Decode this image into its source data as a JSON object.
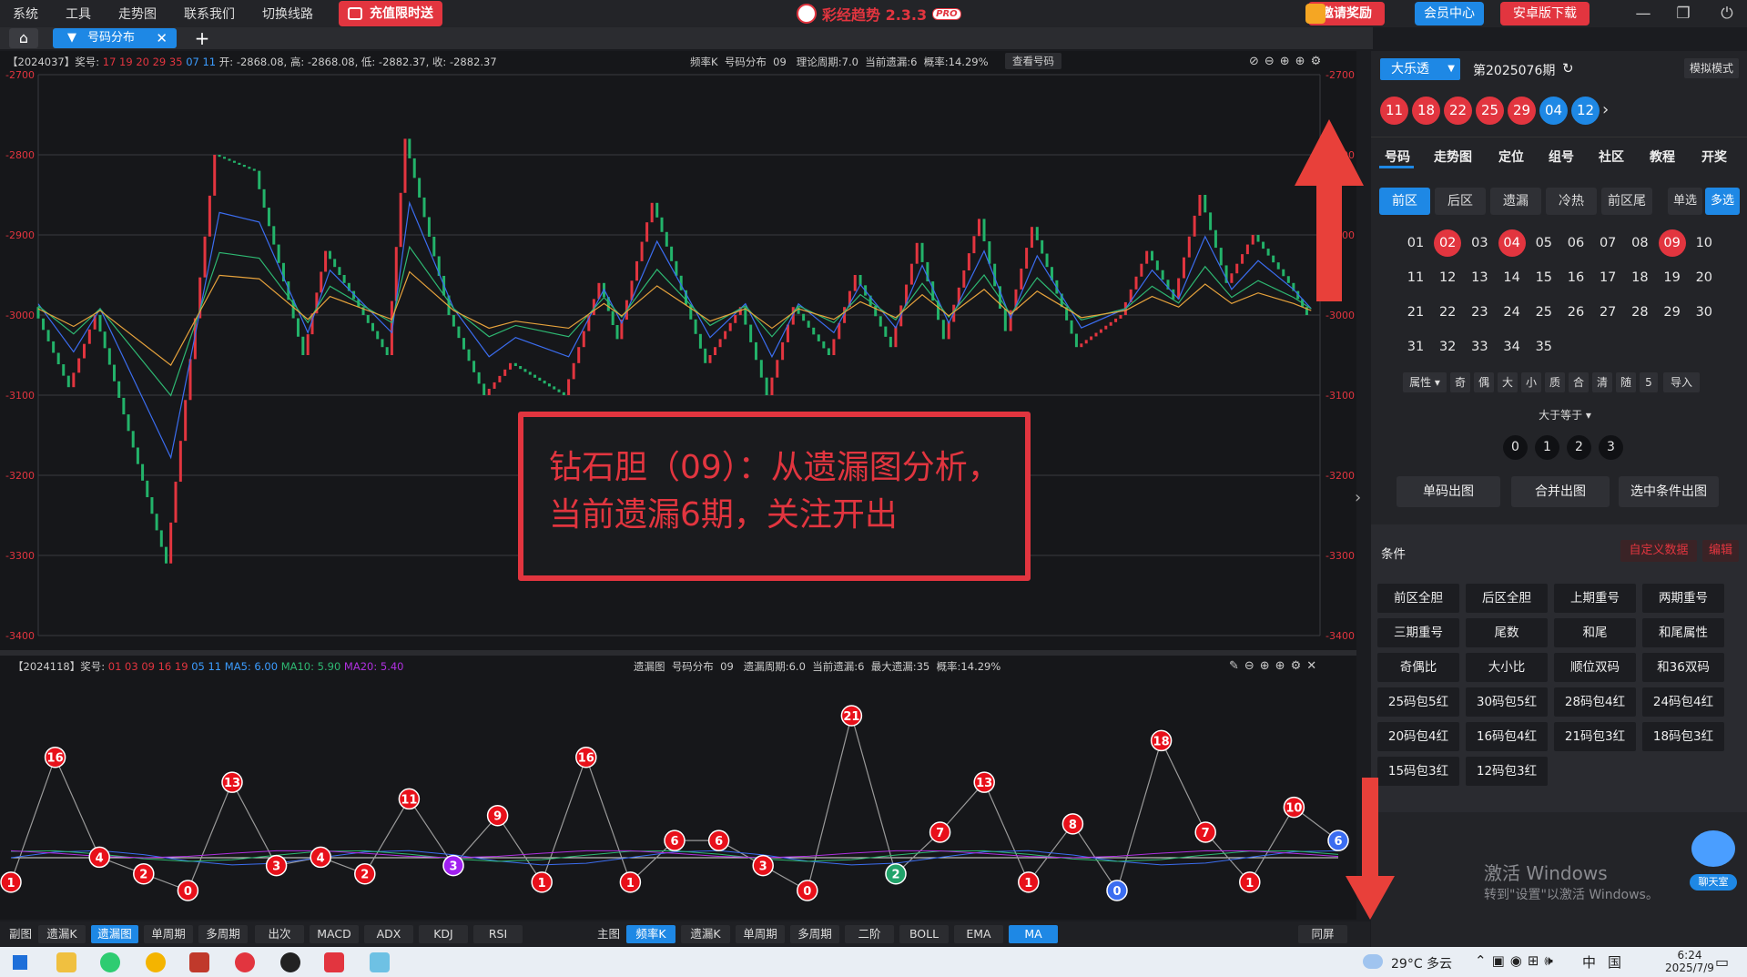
{
  "menu": [
    "系统",
    "工具",
    "走势图",
    "联系我们",
    "切换线路"
  ],
  "recharge_label": "充值限时送",
  "app_title": "彩经趋势 2.3.3",
  "app_badge": "PRO",
  "invite_label": "邀请奖励",
  "member_label": "会员中心",
  "android_label": "安卓版下载",
  "tab_label": "号码分布",
  "main_info": {
    "period": "【2024037】奖号:",
    "draw_red": "17 19 20 29 35",
    "draw_blue": "07 11",
    "ohlc": "开: -2868.08, 高: -2868.08, 低: -2882.37, 收: -2882.37",
    "chart_name": "频率K",
    "dist": "号码分布",
    "ball": "09",
    "theory": "理论周期:7.0",
    "cur_miss": "当前遗漏:6",
    "prob": "概率:14.29%",
    "view_btn": "查看号码"
  },
  "y_labels": [
    "-2700",
    "-2800",
    "-2900",
    "-3000",
    "-3100",
    "-3200",
    "-3300",
    "-3400"
  ],
  "annotation_line1": "钻石胆（09）：从遗漏图分析，",
  "annotation_line2": "当前遗漏6期，关注开出",
  "sub_info": {
    "period": "【2024118】奖号:",
    "draw_red": "01 03 09 16 19",
    "draw_blue": "05 11",
    "ma5": "MA5: 6.00",
    "ma10": "MA10: 5.90",
    "ma20": "MA20: 5.40",
    "chart_name": "遗漏图",
    "dist": "号码分布",
    "ball": "09",
    "theory": "遗漏周期:6.0",
    "cur_miss": "当前遗漏:6",
    "max_miss": "最大遗漏:35",
    "prob": "概率:14.29%"
  },
  "miss_values": [
    1,
    16,
    4,
    2,
    0,
    13,
    3,
    4,
    2,
    11,
    3,
    9,
    1,
    16,
    1,
    6,
    6,
    3,
    0,
    21,
    2,
    7,
    13,
    1,
    8,
    0,
    18,
    7,
    1,
    10,
    6
  ],
  "bottom": {
    "left_label": "副图",
    "left_buttons": [
      "遗漏K",
      "遗漏图",
      "单周期",
      "多周期",
      "出次",
      "MACD",
      "ADX",
      "KDJ",
      "RSI"
    ],
    "main_label": "主图",
    "main_buttons": [
      "频率K",
      "遗漏K",
      "单周期",
      "多周期",
      "二阶",
      "BOLL",
      "EMA",
      "MA"
    ],
    "sync": "同屏"
  },
  "right": {
    "lottery": "大乐透",
    "issue": "第2025076期",
    "mode": "模拟模式",
    "balls_red": [
      "11",
      "18",
      "22",
      "25",
      "29"
    ],
    "balls_blue": [
      "04",
      "12"
    ],
    "nav": [
      "号码",
      "走势图",
      "定位",
      "组号",
      "社区",
      "教程",
      "开奖"
    ],
    "filters": [
      "前区",
      "后区",
      "遗漏",
      "冷热",
      "前区尾"
    ],
    "single": "单选",
    "multi": "多选",
    "numbers": [
      "01",
      "02",
      "03",
      "04",
      "05",
      "06",
      "07",
      "08",
      "09",
      "10",
      "11",
      "12",
      "13",
      "14",
      "15",
      "16",
      "17",
      "18",
      "19",
      "20",
      "21",
      "22",
      "23",
      "24",
      "25",
      "26",
      "27",
      "28",
      "29",
      "30",
      "31",
      "32",
      "33",
      "34",
      "35"
    ],
    "attr_buttons": [
      "属性",
      "奇",
      "偶",
      "大",
      "小",
      "质",
      "合",
      "清",
      "随",
      "5",
      "导入"
    ],
    "gte": "大于等于",
    "counts": [
      "0",
      "1",
      "2",
      "3"
    ],
    "out_buttons": [
      "单码出图",
      "合并出图",
      "选中条件出图"
    ],
    "cond_label": "条件",
    "custom": "自定义数据",
    "edit": "编辑",
    "conditions": [
      "前区全胆",
      "后区全胆",
      "上期重号",
      "两期重号",
      "三期重号",
      "尾数",
      "和尾",
      "和尾属性",
      "奇偶比",
      "大小比",
      "顺位双码",
      "和36双码",
      "25码包5红",
      "30码包5红",
      "28码包4红",
      "24码包4红",
      "20码包4红",
      "16码包4红",
      "21码包3红",
      "18码包3红",
      "15码包3红",
      "12码包3红"
    ]
  },
  "watermark1": "激活 Windows",
  "watermark2": "转到\"设置\"以激活 Windows。",
  "chat": "聊天室",
  "taskbar": {
    "weather": "29°C 多云",
    "time": "6:24",
    "date": "2025/7/9",
    "ime": "中",
    "ime2": "国"
  }
}
